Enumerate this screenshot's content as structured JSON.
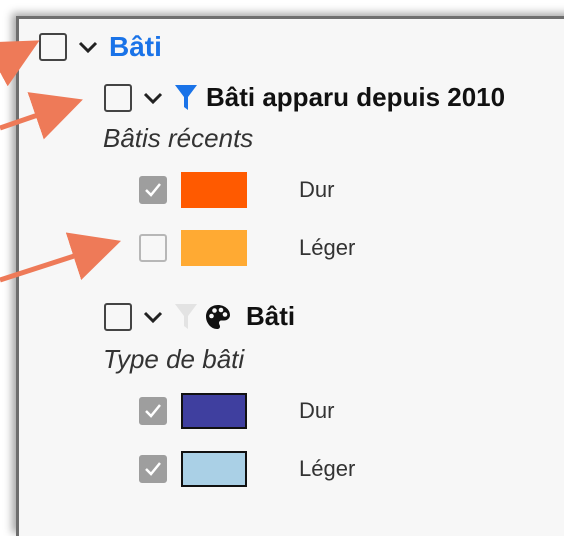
{
  "root_layer": {
    "title": "Bâti",
    "checked": false
  },
  "layers": [
    {
      "title": "Bâti apparu depuis 2010",
      "checked": false,
      "filter_icon_active": true,
      "legend_title": "Bâtis récents",
      "items": [
        {
          "label": "Dur",
          "checked": true,
          "color": "#ff5a00"
        },
        {
          "label": "Léger",
          "checked": false,
          "color": "#ffaa33"
        }
      ]
    },
    {
      "title": "Bâti",
      "checked": false,
      "filter_icon_active": false,
      "legend_title": "Type de bâti",
      "items": [
        {
          "label": "Dur",
          "checked": true,
          "color": "#3f3f9f"
        },
        {
          "label": "Léger",
          "checked": true,
          "color": "#aad0e6"
        }
      ]
    }
  ],
  "colors": {
    "accent": "#1a73e8",
    "arrow": "#ee7a58"
  },
  "icons": [
    "chevron-down-icon",
    "filter-icon",
    "palette-icon",
    "check-icon",
    "arrow-icon"
  ]
}
